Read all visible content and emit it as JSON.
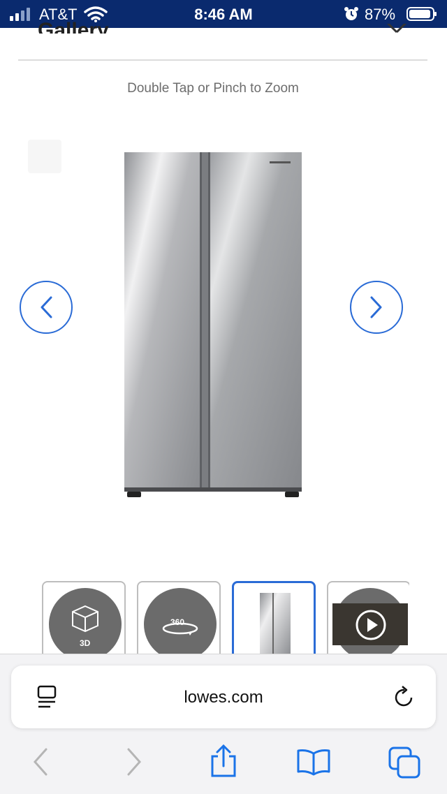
{
  "status_bar": {
    "carrier": "AT&T",
    "time": "8:46 AM",
    "battery_percent": "87%",
    "icons": [
      "signal-icon",
      "wifi-icon",
      "alarm-icon",
      "battery-icon"
    ]
  },
  "header": {
    "title": "Gallery",
    "close_icon": "close-icon"
  },
  "gallery": {
    "zoom_hint": "Double Tap or Pinch to Zoom",
    "prev_icon": "chevron-left-icon",
    "next_icon": "chevron-right-icon",
    "thumbnails": [
      {
        "label": "3D",
        "icon": "cube-3d-icon",
        "active": false
      },
      {
        "label": "360",
        "icon": "rotate-360-icon",
        "active": false
      },
      {
        "label": "",
        "icon": "refrigerator-thumbnail",
        "active": true
      },
      {
        "label": "",
        "icon": "play-video-icon",
        "active": false
      }
    ]
  },
  "browser": {
    "url": "lowes.com",
    "reader_icon": "reader-mode-icon",
    "reload_icon": "reload-icon",
    "toolbar": [
      "back-icon",
      "forward-icon",
      "share-icon",
      "bookmarks-icon",
      "tabs-icon"
    ]
  },
  "colors": {
    "status_bar_bg": "#0a2a6e",
    "accent_blue": "#2a6bd6",
    "toolbar_blue": "#1a73e8",
    "disabled_gray": "#b5b5b5"
  }
}
